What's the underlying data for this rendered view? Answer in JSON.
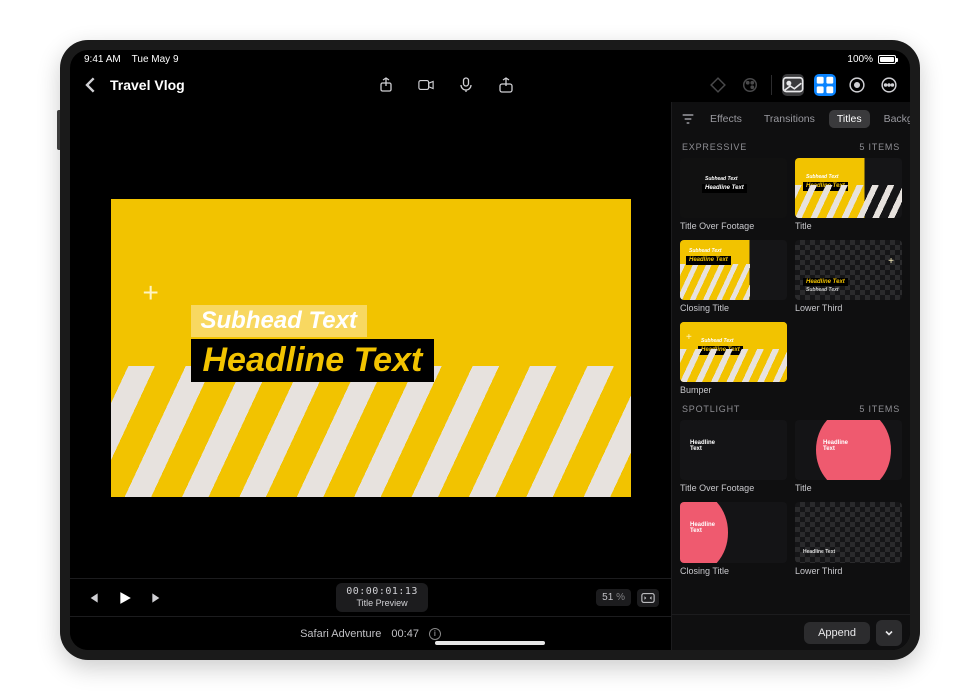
{
  "status": {
    "time": "9:41 AM",
    "date": "Tue May 9",
    "battery_pct": "100%"
  },
  "nav": {
    "project_title": "Travel Vlog"
  },
  "viewer": {
    "subhead": "Subhead Text",
    "headline": "Headline Text"
  },
  "transport": {
    "timecode": "00:00:01:13",
    "timecode_label": "Title Preview",
    "zoom_value": "51",
    "zoom_unit": "%"
  },
  "storyline": {
    "clip_name": "Safari Adventure",
    "clip_dur": "00:47"
  },
  "sidebar": {
    "tabs": [
      "Effects",
      "Transitions",
      "Titles",
      "Backgrounds"
    ],
    "active_tab": "Titles",
    "sections": {
      "expressive": {
        "name": "EXPRESSIVE",
        "count_label": "5 Items",
        "items": [
          {
            "label": "Title Over Footage"
          },
          {
            "label": "Title"
          },
          {
            "label": "Closing Title"
          },
          {
            "label": "Lower Third"
          },
          {
            "label": "Bumper"
          }
        ]
      },
      "spotlight": {
        "name": "SPOTLIGHT",
        "count_label": "5 Items",
        "items": [
          {
            "label": "Title Over Footage"
          },
          {
            "label": "Title"
          },
          {
            "label": "Closing Title"
          },
          {
            "label": "Lower Third"
          }
        ]
      }
    },
    "append_label": "Append"
  },
  "thumb_text": {
    "subhead": "Subhead Text",
    "headline": "Headline Text",
    "spotlight_headline": "Headline\nText"
  },
  "colors": {
    "accent_yellow": "#f2c300",
    "accent_blue": "#0a84ff",
    "spotlight_pink": "#ef5a6f"
  }
}
